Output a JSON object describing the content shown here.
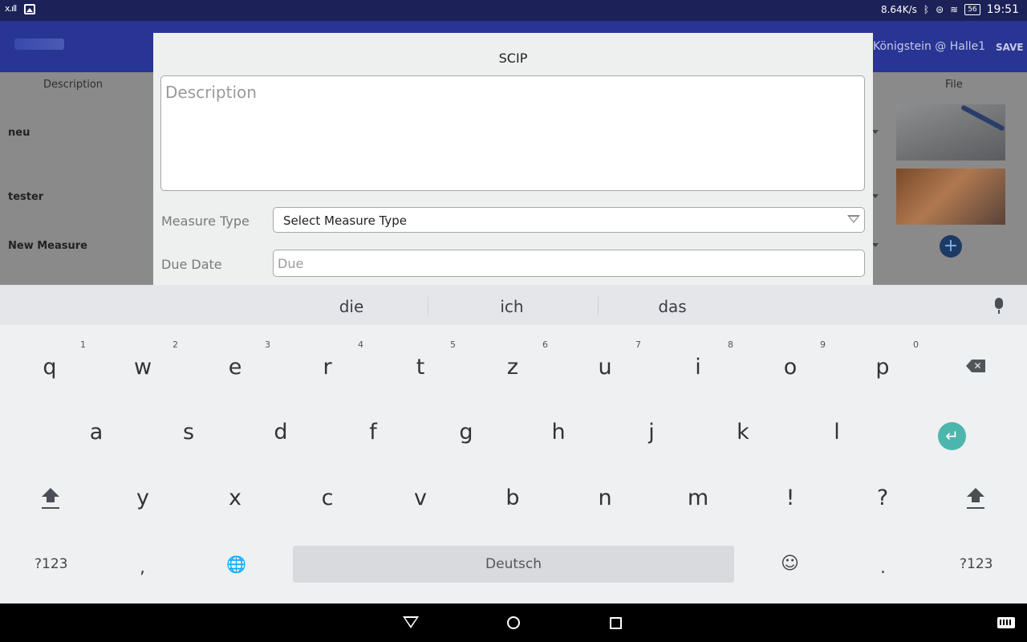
{
  "statusbar": {
    "signal": "x.ıll",
    "net_speed": "8.64K/s",
    "battery": "56",
    "time": "19:51"
  },
  "appbar": {
    "location": "Königstein @ Halle1",
    "save": "SAVE"
  },
  "background": {
    "col_description": "Description",
    "col_file": "File",
    "rows": [
      "neu",
      "tester",
      "New Measure"
    ],
    "add_icon": "+"
  },
  "dialog": {
    "title": "SCIP",
    "description_placeholder": "Description",
    "measure_type_label": "Measure Type",
    "measure_type_value": "Select Measure Type",
    "due_date_label": "Due Date",
    "due_placeholder": "Due"
  },
  "keyboard": {
    "suggestions": [
      "die",
      "ich",
      "das"
    ],
    "row1": [
      "q",
      "w",
      "e",
      "r",
      "t",
      "z",
      "u",
      "i",
      "o",
      "p"
    ],
    "row1_numbers": [
      "1",
      "2",
      "3",
      "4",
      "5",
      "6",
      "7",
      "8",
      "9",
      "0"
    ],
    "row2": [
      "a",
      "s",
      "d",
      "f",
      "g",
      "h",
      "j",
      "k",
      "l"
    ],
    "row3": [
      "y",
      "x",
      "c",
      "v",
      "b",
      "n",
      "m",
      "!",
      "?"
    ],
    "symbols_left": "?123",
    "comma": ",",
    "space": "Deutsch",
    "period": ".",
    "symbols_right": "?123",
    "enter_icon": "↵",
    "globe_icon": "🌐",
    "emoji_icon": "☺"
  },
  "colors": {
    "statusbar": "#1c2257",
    "appbar": "#283593",
    "accent": "#4db6ac"
  }
}
